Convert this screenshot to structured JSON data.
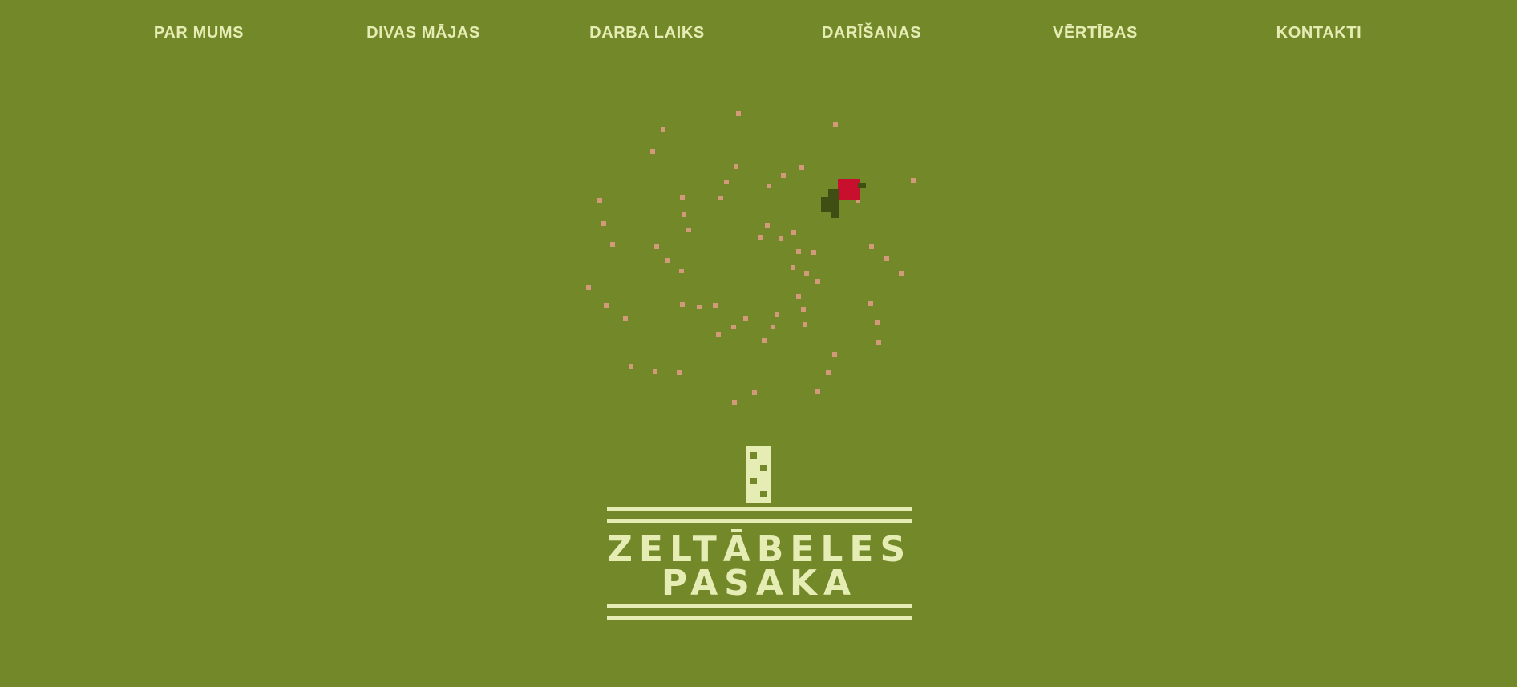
{
  "nav": {
    "items": [
      {
        "label": "PAR MUMS"
      },
      {
        "label": "DIVAS MĀJAS"
      },
      {
        "label": "DARBA LAIKS"
      },
      {
        "label": "DARĪŠANAS"
      },
      {
        "label": "VĒRTĪBAS"
      },
      {
        "label": "KONTAKTI"
      }
    ]
  },
  "logo": {
    "line1": "ZELTĀBELES",
    "line2": "PASAKA",
    "icon": "folk-pattern-apple-tree-icon"
  },
  "colors": {
    "background": "#738829",
    "foreground": "#e6edb4",
    "apple": "#c8102e",
    "leaf": "#3f4e12",
    "speckle": "#d29a7a"
  }
}
